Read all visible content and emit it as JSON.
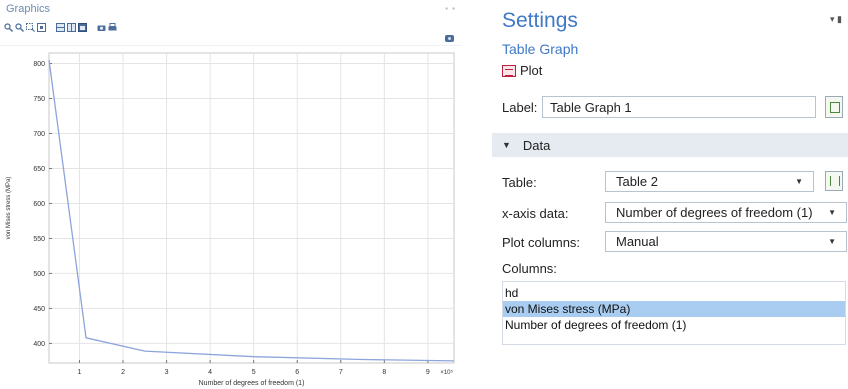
{
  "graphics": {
    "title": "Graphics",
    "toolbar_icons": [
      "zoom-in-icon",
      "zoom-out-icon",
      "zoom-box-icon",
      "zoom-extents-icon",
      "grid-icon",
      "layout-icon",
      "window-icon",
      "camera-icon",
      "print-icon"
    ],
    "corner": "▪ ▪",
    "screenshot_icon": "camera-icon"
  },
  "chart_data": {
    "type": "line",
    "x": [
      0.3,
      1.15,
      2.5,
      5.0,
      7.5,
      9.6
    ],
    "values": [
      805,
      408,
      389,
      381,
      377,
      375
    ],
    "xlabel": "Number of degrees of freedom (1)",
    "ylabel": "von Mises stress (MPa)",
    "xlim": [
      0.3,
      9.6
    ],
    "ylim": [
      372,
      815
    ],
    "x_ticks": [
      1,
      2,
      3,
      4,
      5,
      6,
      7,
      8,
      9
    ],
    "y_ticks": [
      400,
      450,
      500,
      550,
      600,
      650,
      700,
      750,
      800
    ],
    "x_multiplier": "×10⁵",
    "grid": true,
    "line_color": "#8da4dc"
  },
  "settings": {
    "title": "Settings",
    "pin": "▾ ▮",
    "subtitle": "Table Graph",
    "plot_button": "Plot",
    "label_caption": "Label:",
    "label_value": "Table Graph 1",
    "section_title": "Data",
    "table_caption": "Table:",
    "table_value": "Table 2",
    "xaxis_caption": "x-axis data:",
    "xaxis_value": "Number of degrees of freedom (1)",
    "plotcols_caption": "Plot columns:",
    "plotcols_value": "Manual",
    "columns_caption": "Columns:",
    "columns": [
      {
        "label": "hd",
        "selected": false
      },
      {
        "label": "von Mises stress (MPa)",
        "selected": true
      },
      {
        "label": "Number of degrees of freedom (1)",
        "selected": false
      }
    ]
  }
}
